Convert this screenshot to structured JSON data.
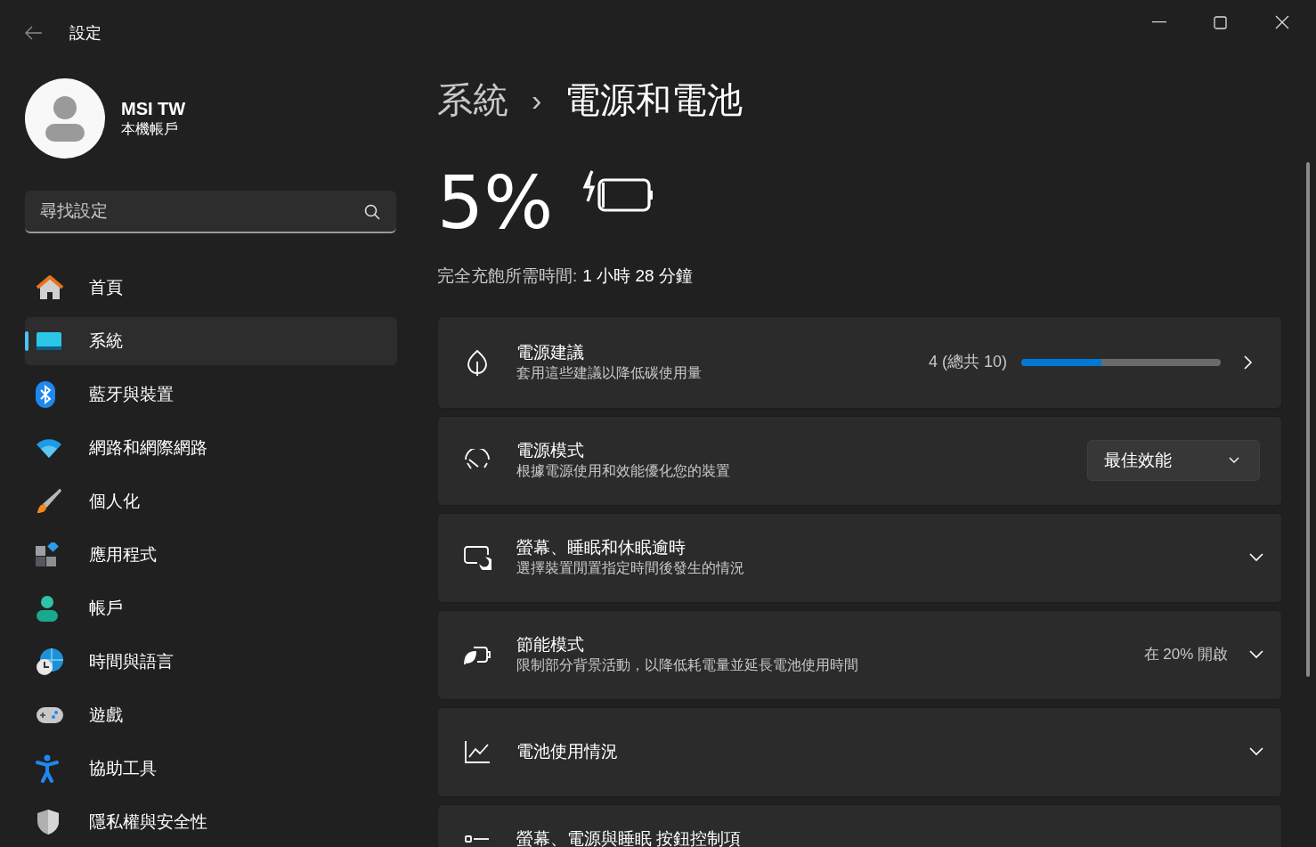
{
  "window": {
    "title": "設定"
  },
  "profile": {
    "name": "MSI TW",
    "account_type": "本機帳戶"
  },
  "search": {
    "placeholder": "尋找設定"
  },
  "nav": {
    "items": [
      {
        "label": "首頁",
        "selected": false
      },
      {
        "label": "系統",
        "selected": true
      },
      {
        "label": "藍牙與裝置",
        "selected": false
      },
      {
        "label": "網路和網際網路",
        "selected": false
      },
      {
        "label": "個人化",
        "selected": false
      },
      {
        "label": "應用程式",
        "selected": false
      },
      {
        "label": "帳戶",
        "selected": false
      },
      {
        "label": "時間與語言",
        "selected": false
      },
      {
        "label": "遊戲",
        "selected": false
      },
      {
        "label": "協助工具",
        "selected": false
      },
      {
        "label": "隱私權與安全性",
        "selected": false
      }
    ]
  },
  "breadcrumb": {
    "parent": "系統",
    "separator": "›",
    "current": "電源和電池"
  },
  "battery": {
    "percent": "5%",
    "charging": true,
    "level": 0.05,
    "charge_time_label": "完全充飽所需時間:",
    "charge_time_value": "1 小時 28 分鐘"
  },
  "cards": [
    {
      "kind": "progress",
      "title": "電源建議",
      "subtitle": "套用這些建議以降低碳使用量",
      "count": "4 (總共 10)",
      "level": 0.4
    },
    {
      "kind": "dropdown",
      "title": "電源模式",
      "subtitle": "根據電源使用和效能優化您的裝置",
      "value": "最佳效能"
    },
    {
      "kind": "expander",
      "title": "螢幕、睡眠和休眠逾時",
      "subtitle": "選擇裝置閒置指定時間後發生的情況",
      "expanded": false
    },
    {
      "kind": "expander",
      "title": "節能模式",
      "subtitle": "限制部分背景活動，以降低耗電量並延長電池使用時間",
      "status": "在 20% 開啟",
      "expanded": false
    },
    {
      "kind": "expander",
      "title": "電池使用情況",
      "expanded": false
    },
    {
      "kind": "expander",
      "title": "螢幕、電源與睡眠 按鈕控制項"
    }
  ]
}
